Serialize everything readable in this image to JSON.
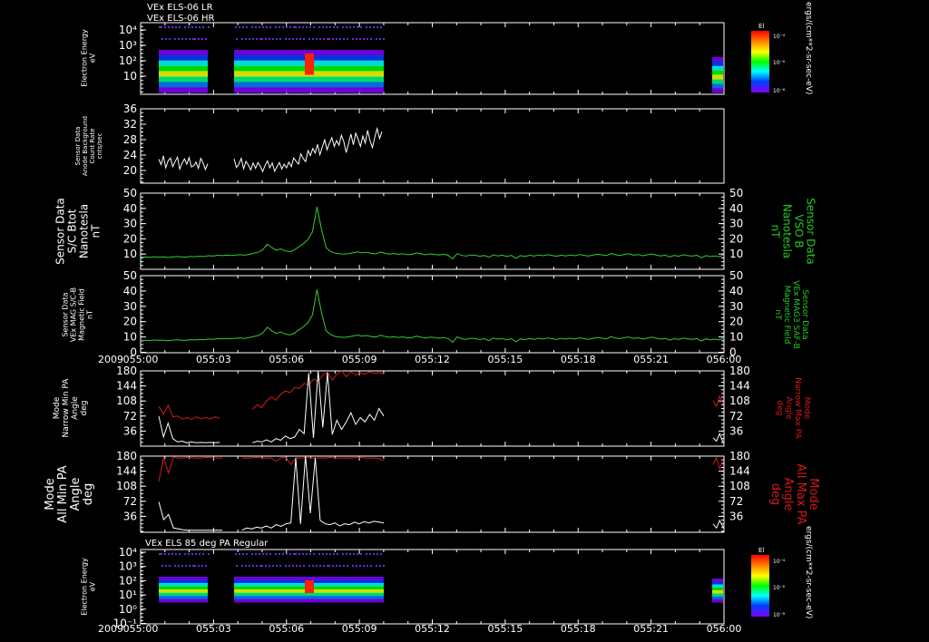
{
  "header": {
    "line1": "VEx ELS-06 LR",
    "line2": "VEx ELS-06 HR",
    "bottom_title": "VEx ELS 85 deg PA Regular"
  },
  "colorbar": {
    "label": "El",
    "unit": "ergs/(cm**2-sr-sec-eV)",
    "ticks": [
      "10⁻⁴",
      "10⁻⁶",
      "10⁻⁸"
    ]
  },
  "time_axis": {
    "year": "2009",
    "ticks": [
      "055:00",
      "055:03",
      "055:06",
      "055:09",
      "055:12",
      "055:15",
      "055:18",
      "055:21",
      "056:00"
    ]
  },
  "colors": {
    "background": "#000000",
    "axis": "#ffffff",
    "green_trace": "#33cc33",
    "green_label": "#22cc22",
    "red_trace": "#d21a1a",
    "white_trace": "#ffffff"
  },
  "chart_data": [
    {
      "type": "heatmap",
      "ylabel": [
        "Electron Energy",
        "eV"
      ],
      "yticks": [
        "10⁴",
        "10³",
        "10²",
        "10"
      ],
      "scale": "log",
      "data_segments_time": [
        [
          "055:00",
          "055:02.3"
        ],
        [
          "055:03.1",
          "055:09.4"
        ],
        [
          "055:23.9",
          "056:00"
        ]
      ]
    },
    {
      "type": "line",
      "ylabel": [
        "Sensor Data",
        "Anode Background",
        "Count Rate",
        "cnts/sec"
      ],
      "yticks": [
        "36",
        "32",
        "28",
        "24",
        "20"
      ],
      "ylim": [
        18,
        36
      ],
      "series": [
        {
          "values": [
            23.8,
            22.5,
            24.6,
            21.7,
            23.4,
            24.1,
            22.0,
            23.2,
            24.3,
            21.4,
            22.8,
            23.9,
            22.6,
            24.2,
            21.9,
            22.2,
            23.1,
            21.6,
            24.0,
            22.9,
            21.3,
            22.7,
            23.9,
            21.8,
            22.6,
            24.0,
            21.5,
            23.3,
            22.4,
            21.2,
            22.9,
            21.6,
            23.0,
            22.1,
            20.8,
            22.3,
            23.4,
            21.7,
            22.9,
            20.9,
            22.0,
            23.0,
            21.4,
            22.6,
            21.7,
            23.1,
            22.0,
            24.1,
            23.3,
            22.6,
            25.1,
            24.0,
            23.2,
            25.9,
            24.7,
            26.4,
            25.3,
            27.4,
            24.9,
            26.8,
            28.5,
            26.1,
            27.7,
            29.0,
            26.9,
            28.3,
            27.2,
            29.6,
            28.1,
            25.4,
            27.6,
            29.9,
            27.3,
            30.1,
            28.7,
            26.9,
            29.4,
            27.7,
            30.8,
            28.3,
            26.6,
            29.1,
            31.2,
            28.8,
            30.5
          ]
        }
      ]
    },
    {
      "type": "line",
      "ylabel": [
        "Sensor Data",
        "S/C Btot",
        "Nanotesla",
        "nT"
      ],
      "ylabel_right": [
        "Sensor Data",
        "VSO B",
        "Nanotesla",
        "nT"
      ],
      "yticks": [
        "50",
        "40",
        "30",
        "20",
        "10"
      ],
      "ylim": [
        0,
        50
      ],
      "series": [
        {
          "values": [
            8.0,
            8.1,
            7.9,
            8.3,
            8.0,
            8.2,
            7.8,
            8.1,
            8.4,
            8.2,
            8.0,
            8.5,
            8.3,
            8.6,
            8.4,
            8.9,
            8.7,
            9.2,
            9.0,
            9.3,
            9.1,
            9.4,
            9.6,
            9.3,
            9.8,
            10.5,
            11.2,
            12.8,
            16.5,
            14.2,
            12.6,
            13.4,
            12.1,
            11.5,
            12.7,
            14.9,
            16.8,
            19.5,
            24.6,
            41.0,
            26.2,
            14.3,
            11.8,
            10.6,
            10.2,
            10.0,
            10.3,
            10.9,
            11.4,
            10.8,
            11.2,
            10.5,
            10.1,
            11.3,
            10.6,
            10.0,
            10.4,
            9.8,
            10.3,
            9.6,
            9.9,
            10.7,
            10.2,
            9.5,
            10.1,
            9.8,
            9.4,
            9.9,
            9.2,
            6.8,
            10.3,
            9.1,
            8.7,
            9.4,
            9.2,
            8.6,
            9.1,
            7.9,
            9.5,
            8.8,
            9.3,
            8.4,
            9.1,
            7.2,
            9.0,
            8.5,
            9.2,
            8.7,
            9.4,
            8.9,
            9.6,
            9.1,
            8.6,
            9.3,
            8.8,
            9.4,
            8.9,
            9.7,
            9.2,
            8.7,
            9.3,
            9.9,
            9.5,
            9.0,
            10.4,
            9.6,
            9.1,
            9.8,
            10.2,
            9.3,
            9.7,
            8.9,
            9.5,
            10.1,
            9.4,
            8.8,
            9.3,
            8.2,
            9.1,
            8.6,
            9.5,
            9.0,
            8.7,
            9.2,
            7.6,
            9.0,
            8.4,
            8.8,
            8.3,
            9.6
          ]
        }
      ]
    },
    {
      "type": "line",
      "ylabel": [
        "Sensor Data",
        "VEx MAG S/C-B",
        "Magnetic Field",
        "nT"
      ],
      "ylabel_right": [
        "Sensor Data",
        "VEx MAG3 SAF-B",
        "Magnetic Field",
        "nT"
      ],
      "yticks": [
        "50",
        "40",
        "30",
        "20",
        "10",
        "0"
      ],
      "ylim": [
        0,
        50
      ],
      "series": [
        {
          "values": [
            8.0,
            8.1,
            7.9,
            8.3,
            8.0,
            8.2,
            7.8,
            8.1,
            8.4,
            8.2,
            8.0,
            8.5,
            8.3,
            8.6,
            8.4,
            8.9,
            8.7,
            9.2,
            9.0,
            9.3,
            9.1,
            9.4,
            9.6,
            9.3,
            9.8,
            10.5,
            11.2,
            12.8,
            16.5,
            14.2,
            12.6,
            13.4,
            12.1,
            11.5,
            12.7,
            14.9,
            16.8,
            19.5,
            24.6,
            41.0,
            26.2,
            14.3,
            11.8,
            10.6,
            10.2,
            10.0,
            10.3,
            10.9,
            11.4,
            10.8,
            11.2,
            10.5,
            10.1,
            11.3,
            10.6,
            10.0,
            10.4,
            9.8,
            10.3,
            9.6,
            9.9,
            10.7,
            10.2,
            9.5,
            10.1,
            9.8,
            9.4,
            9.9,
            9.2,
            6.8,
            10.3,
            9.1,
            8.7,
            9.4,
            9.2,
            8.6,
            9.1,
            7.9,
            9.5,
            8.8,
            9.3,
            8.4,
            9.1,
            7.2,
            9.0,
            8.5,
            9.2,
            8.7,
            9.4,
            8.9,
            9.6,
            9.1,
            8.6,
            9.3,
            8.8,
            9.4,
            8.9,
            9.7,
            9.2,
            8.7,
            9.3,
            9.9,
            9.5,
            9.0,
            10.4,
            9.6,
            9.1,
            9.8,
            10.2,
            9.3,
            9.7,
            8.9,
            9.5,
            10.1,
            9.4,
            8.8,
            9.3,
            8.2,
            9.1,
            8.6,
            9.5,
            9.0,
            8.7,
            9.2,
            7.6,
            9.0,
            8.4,
            8.8,
            8.3,
            9.6
          ]
        }
      ]
    },
    {
      "type": "line",
      "ylabel": [
        "Mode",
        "Narrow Min PA",
        "Angle",
        "deg"
      ],
      "ylabel_right": [
        "Mode",
        "Narrow Max PA",
        "Angle",
        "deg"
      ],
      "yticks": [
        "180",
        "144",
        "108",
        "72",
        "36"
      ],
      "ylim": [
        0,
        180
      ],
      "series": [
        {
          "values": [
            95,
            76,
            98,
            70,
            72,
            65,
            68,
            64,
            70,
            66,
            68,
            65,
            70,
            67,
            null,
            null,
            null,
            null,
            null,
            null,
            88,
            99,
            92,
            108,
            118,
            110,
            124,
            132,
            128,
            140,
            138,
            150,
            146,
            160,
            156,
            170,
            176,
            158,
            172,
            180,
            166,
            178,
            170,
            175,
            172,
            178,
            174,
            176,
            172
          ]
        },
        {
          "values": [
            72,
            22,
            55,
            18,
            10,
            12,
            8,
            10,
            8,
            9,
            8,
            9,
            8,
            9,
            null,
            null,
            null,
            null,
            null,
            null,
            8,
            12,
            10,
            15,
            10,
            18,
            14,
            24,
            18,
            22,
            40,
            30,
            175,
            20,
            180,
            45,
            176,
            28,
            62,
            40,
            58,
            80,
            52,
            68,
            58,
            76,
            62,
            90,
            72
          ]
        }
      ]
    },
    {
      "type": "line",
      "ylabel": [
        "Mode",
        "All Min PA",
        "Angle",
        "deg"
      ],
      "ylabel_right": [
        "Mode",
        "All Max PA",
        "Angle",
        "deg"
      ],
      "yticks": [
        "180",
        "144",
        "108",
        "72",
        "36"
      ],
      "ylim": [
        0,
        180
      ],
      "series": [
        {
          "values": [
            120,
            176,
            140,
            178,
            175,
            176,
            177,
            176,
            175,
            176,
            177,
            176,
            175,
            176,
            null,
            null,
            null,
            176,
            175,
            176,
            177,
            176,
            175,
            176,
            168,
            176,
            177,
            160,
            176,
            175,
            177,
            176,
            175,
            176,
            175,
            177,
            176,
            175,
            176,
            175,
            176,
            177,
            176,
            175,
            176,
            174,
            170
          ]
        },
        {
          "values": [
            72,
            30,
            42,
            10,
            8,
            6,
            5,
            5,
            5,
            5,
            5,
            5,
            5,
            5,
            null,
            null,
            null,
            5,
            10,
            8,
            12,
            10,
            15,
            10,
            18,
            14,
            20,
            22,
            175,
            20,
            180,
            45,
            176,
            28,
            20,
            18,
            22,
            15,
            20,
            18,
            24,
            20,
            25,
            22,
            26,
            24,
            22
          ]
        }
      ]
    },
    {
      "type": "heatmap",
      "title": "VEx ELS 85 deg PA Regular",
      "ylabel": [
        "Electron Energy",
        "eV"
      ],
      "yticks": [
        "10⁴",
        "10³",
        "10²",
        "10¹",
        "10⁰",
        "10⁻¹"
      ],
      "scale": "log"
    }
  ]
}
